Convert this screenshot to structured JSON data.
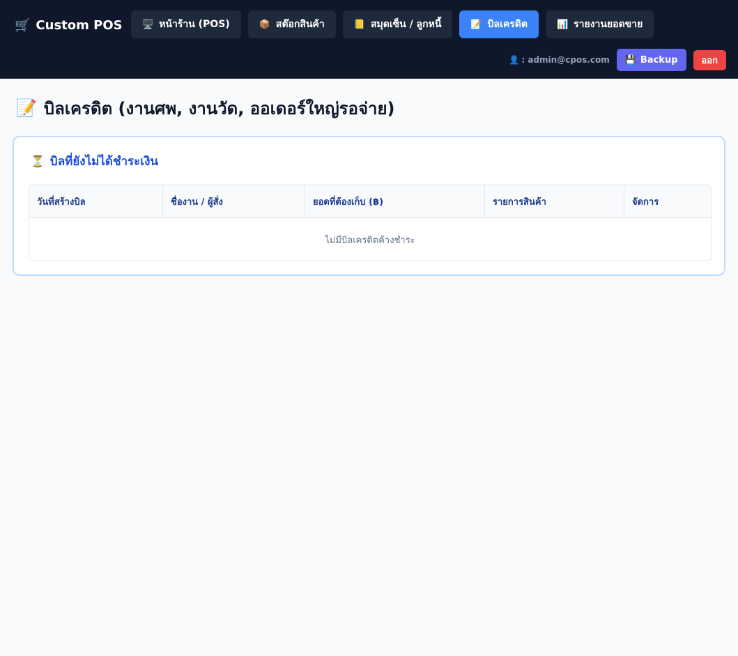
{
  "app": {
    "title": "Custom POS",
    "brand_icon": "🛒"
  },
  "nav": {
    "items": [
      {
        "icon": "🖥️",
        "label": "หน้าร้าน (POS)"
      },
      {
        "icon": "📦",
        "label": "สต๊อกสินค้า"
      },
      {
        "icon": "📒",
        "label": "สมุดเซ็น / ลูกหนี้"
      },
      {
        "icon": "📝",
        "label": "บิลเครดิต"
      },
      {
        "icon": "📊",
        "label": "รายงานยอดขาย"
      }
    ],
    "active_index": 3
  },
  "userbar": {
    "user_icon": "👤",
    "user_text": ": admin@cpos.com",
    "backup_icon": "💾",
    "backup_label": "Backup",
    "logout_label": "ออก"
  },
  "page": {
    "icon": "📝",
    "title": "บิลเครดิต (งานศพ, งานวัด, ออเดอร์ใหญ่รอจ่าย)"
  },
  "card": {
    "icon": "⏳",
    "title": "บิลที่ยังไม่ได้ชำระเงิน",
    "table": {
      "columns": [
        "วันที่สร้างบิล",
        "ชื่องาน / ผู้สั่ง",
        "ยอดที่ต้องเก็บ (฿)",
        "รายการสินค้า",
        "จัดการ"
      ],
      "empty_text": "ไม่มีบิลเครดิตค้างชำระ"
    }
  },
  "colors": {
    "topbar": "#0f172a",
    "nav_button": "#1e293b",
    "nav_active": "#3b82f6",
    "backup": "#6366f1",
    "logout": "#ef4444",
    "card_border": "#bfdbfe",
    "card_title": "#1d4ed8"
  }
}
